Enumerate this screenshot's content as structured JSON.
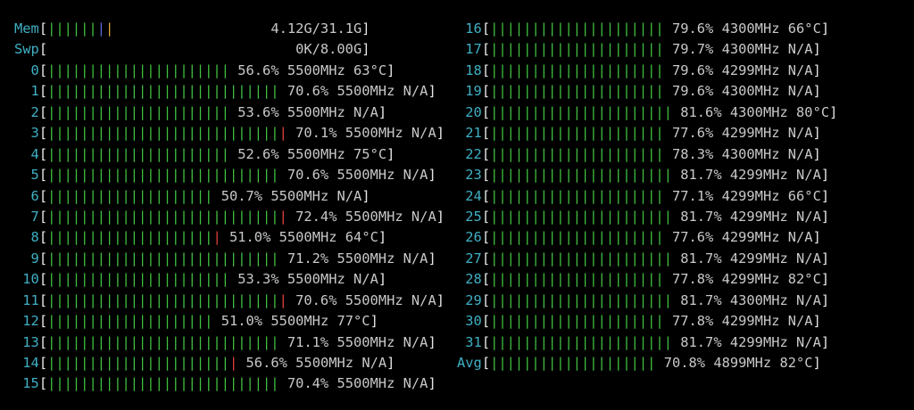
{
  "colors": {
    "background": "#000000",
    "label": "#3fb0c4",
    "bracket": "#e6e6e6",
    "bar_green": "#3fbf3f",
    "bar_red": "#e0413c",
    "bar_blue": "#5b6bd8",
    "bar_orange": "#e6a53c",
    "value_text": "#c8c8c8"
  },
  "meters": [
    {
      "id": "mem",
      "label": "Mem",
      "value": "4.12G/31.1G",
      "bar_fraction": 0.132,
      "segments": [
        {
          "text": "||||||",
          "color": "green"
        },
        {
          "text": "|",
          "color": "blue"
        },
        {
          "text": "|",
          "color": "orange"
        }
      ]
    },
    {
      "id": "swp",
      "label": "Swp",
      "value": "0K/8.00G",
      "bar_fraction": 0.0,
      "segments": []
    }
  ],
  "cpus_left": [
    {
      "label": "0",
      "percent": "56.6%",
      "freq": "5500MHz",
      "temp": "63°C",
      "segments": [
        {
          "text": "||||||||||||||||||||||",
          "color": "green"
        }
      ]
    },
    {
      "label": "1",
      "percent": "70.6%",
      "freq": "5500MHz",
      "temp": "N/A",
      "segments": [
        {
          "text": "||||||||||||||||||||||||||||",
          "color": "green"
        }
      ]
    },
    {
      "label": "2",
      "percent": "53.6%",
      "freq": "5500MHz",
      "temp": "N/A",
      "segments": [
        {
          "text": "||||||||||||||||||||||",
          "color": "green"
        }
      ]
    },
    {
      "label": "3",
      "percent": "70.1%",
      "freq": "5500MHz",
      "temp": "N/A",
      "segments": [
        {
          "text": "||||||||||||||||||||||||||||",
          "color": "green"
        },
        {
          "text": "|",
          "color": "red"
        }
      ]
    },
    {
      "label": "4",
      "percent": "52.6%",
      "freq": "5500MHz",
      "temp": "75°C",
      "segments": [
        {
          "text": "||||||||||||||||||||||",
          "color": "green"
        }
      ]
    },
    {
      "label": "5",
      "percent": "70.6%",
      "freq": "5500MHz",
      "temp": "N/A",
      "segments": [
        {
          "text": "||||||||||||||||||||||||||||",
          "color": "green"
        }
      ]
    },
    {
      "label": "6",
      "percent": "50.7%",
      "freq": "5500MHz",
      "temp": "N/A",
      "segments": [
        {
          "text": "||||||||||||||||||||",
          "color": "green"
        }
      ]
    },
    {
      "label": "7",
      "percent": "72.4%",
      "freq": "5500MHz",
      "temp": "N/A",
      "segments": [
        {
          "text": "||||||||||||||||||||||||||||",
          "color": "green"
        },
        {
          "text": "|",
          "color": "red"
        }
      ]
    },
    {
      "label": "8",
      "percent": "51.0%",
      "freq": "5500MHz",
      "temp": "64°C",
      "segments": [
        {
          "text": "||||||||||||||||||||",
          "color": "green"
        },
        {
          "text": "|",
          "color": "red"
        }
      ]
    },
    {
      "label": "9",
      "percent": "71.2%",
      "freq": "5500MHz",
      "temp": "N/A",
      "segments": [
        {
          "text": "||||||||||||||||||||||||||||",
          "color": "green"
        }
      ]
    },
    {
      "label": "10",
      "percent": "53.3%",
      "freq": "5500MHz",
      "temp": "N/A",
      "segments": [
        {
          "text": "||||||||||||||||||||||",
          "color": "green"
        }
      ]
    },
    {
      "label": "11",
      "percent": "70.6%",
      "freq": "5500MHz",
      "temp": "N/A",
      "segments": [
        {
          "text": "||||||||||||||||||||||||||||",
          "color": "green"
        },
        {
          "text": "|",
          "color": "red"
        }
      ]
    },
    {
      "label": "12",
      "percent": "51.0%",
      "freq": "5500MHz",
      "temp": "77°C",
      "segments": [
        {
          "text": "||||||||||||||||||||",
          "color": "green"
        }
      ]
    },
    {
      "label": "13",
      "percent": "71.1%",
      "freq": "5500MHz",
      "temp": "N/A",
      "segments": [
        {
          "text": "||||||||||||||||||||||||||||",
          "color": "green"
        }
      ]
    },
    {
      "label": "14",
      "percent": "56.6%",
      "freq": "5500MHz",
      "temp": "N/A",
      "segments": [
        {
          "text": "||||||||||||||||||||||",
          "color": "green"
        },
        {
          "text": "|",
          "color": "red"
        }
      ]
    },
    {
      "label": "15",
      "percent": "70.4%",
      "freq": "5500MHz",
      "temp": "N/A",
      "segments": [
        {
          "text": "||||||||||||||||||||||||||||",
          "color": "green"
        }
      ]
    }
  ],
  "cpus_right": [
    {
      "label": "16",
      "percent": "79.6%",
      "freq": "4300MHz",
      "temp": "66°C",
      "segments": [
        {
          "text": "|||||||||||||||||||||",
          "color": "green"
        }
      ]
    },
    {
      "label": "17",
      "percent": "79.7%",
      "freq": "4300MHz",
      "temp": "N/A",
      "segments": [
        {
          "text": "|||||||||||||||||||||",
          "color": "green"
        }
      ]
    },
    {
      "label": "18",
      "percent": "79.6%",
      "freq": "4299MHz",
      "temp": "N/A",
      "segments": [
        {
          "text": "|||||||||||||||||||||",
          "color": "green"
        }
      ]
    },
    {
      "label": "19",
      "percent": "79.6%",
      "freq": "4300MHz",
      "temp": "N/A",
      "segments": [
        {
          "text": "|||||||||||||||||||||",
          "color": "green"
        }
      ]
    },
    {
      "label": "20",
      "percent": "81.6%",
      "freq": "4300MHz",
      "temp": "80°C",
      "segments": [
        {
          "text": "||||||||||||||||||||||",
          "color": "green"
        }
      ]
    },
    {
      "label": "21",
      "percent": "77.6%",
      "freq": "4299MHz",
      "temp": "N/A",
      "segments": [
        {
          "text": "|||||||||||||||||||||",
          "color": "green"
        }
      ]
    },
    {
      "label": "22",
      "percent": "78.3%",
      "freq": "4300MHz",
      "temp": "N/A",
      "segments": [
        {
          "text": "|||||||||||||||||||||",
          "color": "green"
        }
      ]
    },
    {
      "label": "23",
      "percent": "81.7%",
      "freq": "4299MHz",
      "temp": "N/A",
      "segments": [
        {
          "text": "||||||||||||||||||||||",
          "color": "green"
        }
      ]
    },
    {
      "label": "24",
      "percent": "77.1%",
      "freq": "4299MHz",
      "temp": "66°C",
      "segments": [
        {
          "text": "|||||||||||||||||||||",
          "color": "green"
        }
      ]
    },
    {
      "label": "25",
      "percent": "81.7%",
      "freq": "4299MHz",
      "temp": "N/A",
      "segments": [
        {
          "text": "||||||||||||||||||||||",
          "color": "green"
        }
      ]
    },
    {
      "label": "26",
      "percent": "77.6%",
      "freq": "4299MHz",
      "temp": "N/A",
      "segments": [
        {
          "text": "|||||||||||||||||||||",
          "color": "green"
        }
      ]
    },
    {
      "label": "27",
      "percent": "81.7%",
      "freq": "4299MHz",
      "temp": "N/A",
      "segments": [
        {
          "text": "||||||||||||||||||||||",
          "color": "green"
        }
      ]
    },
    {
      "label": "28",
      "percent": "77.8%",
      "freq": "4299MHz",
      "temp": "82°C",
      "segments": [
        {
          "text": "|||||||||||||||||||||",
          "color": "green"
        }
      ]
    },
    {
      "label": "29",
      "percent": "81.7%",
      "freq": "4300MHz",
      "temp": "N/A",
      "segments": [
        {
          "text": "||||||||||||||||||||||",
          "color": "green"
        }
      ]
    },
    {
      "label": "30",
      "percent": "77.8%",
      "freq": "4299MHz",
      "temp": "N/A",
      "segments": [
        {
          "text": "|||||||||||||||||||||",
          "color": "green"
        }
      ]
    },
    {
      "label": "31",
      "percent": "81.7%",
      "freq": "4299MHz",
      "temp": "N/A",
      "segments": [
        {
          "text": "||||||||||||||||||||||",
          "color": "green"
        }
      ]
    },
    {
      "label": "Avg",
      "percent": "70.8%",
      "freq": "4899MHz",
      "temp": "82°C",
      "segments": [
        {
          "text": "||||||||||||||||||||",
          "color": "green"
        }
      ]
    }
  ]
}
